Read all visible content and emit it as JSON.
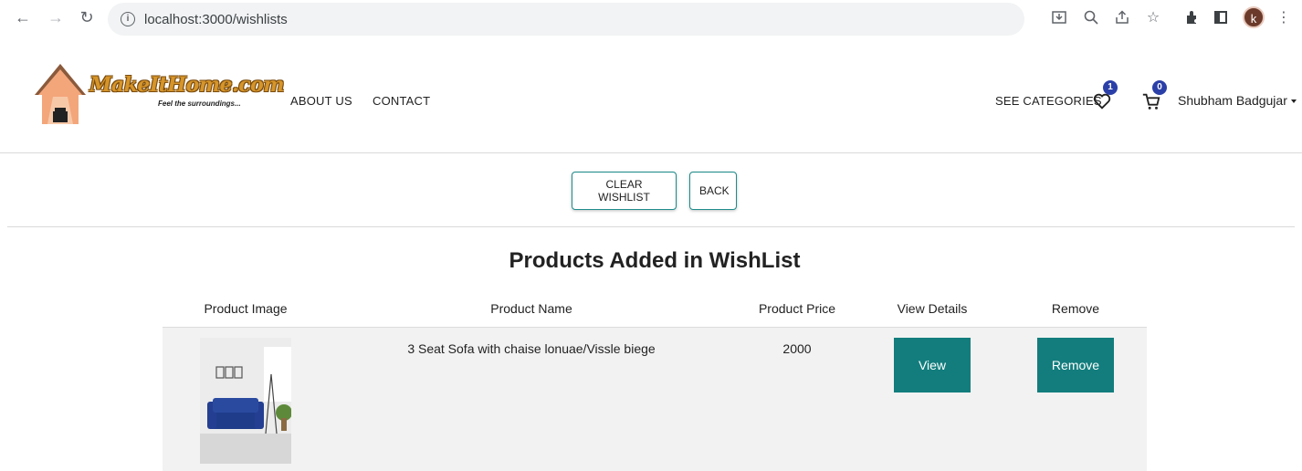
{
  "browser": {
    "url": "localhost:3000/wishlists",
    "profile_initial": "k"
  },
  "header": {
    "logo_text": "MakeItHome.com",
    "logo_tagline": "Feel the surroundings...",
    "nav": {
      "about": "ABOUT US",
      "contact": "CONTACT",
      "categories": "SEE CATEGORIES"
    },
    "wishlist_count": "1",
    "cart_count": "0",
    "user_name": "Shubham Badgujar"
  },
  "actions": {
    "clear_label": "CLEAR WISHLIST",
    "back_label": "BACK"
  },
  "wishlist": {
    "title": "Products Added in WishList",
    "columns": [
      "Product Image",
      "Product Name",
      "Product Price",
      "View Details",
      "Remove"
    ],
    "rows": [
      {
        "name": "3 Seat Sofa with chaise lonuae/Vissle biege",
        "price": "2000",
        "view_label": "View",
        "remove_label": "Remove"
      }
    ]
  },
  "colors": {
    "accent": "#137d7d",
    "badge": "#2b3fa8"
  }
}
